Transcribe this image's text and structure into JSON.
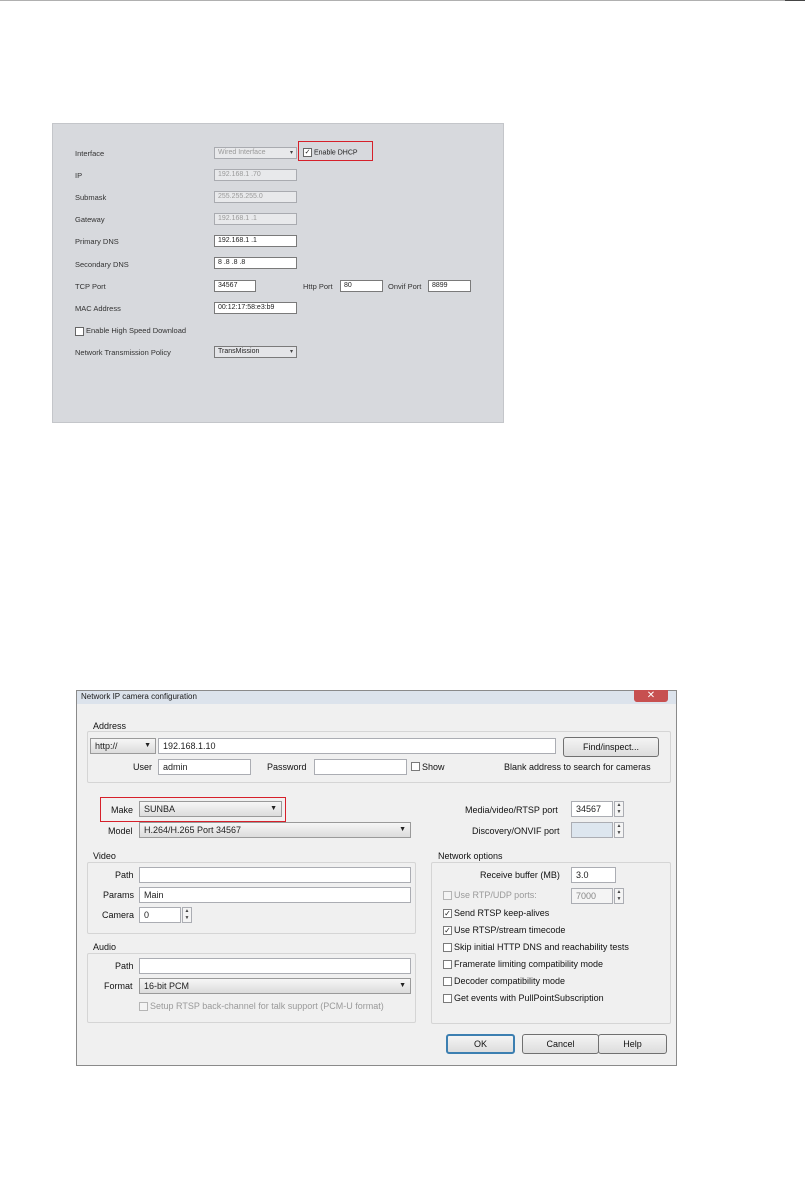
{
  "network_panel": {
    "interface": {
      "label": "Interface",
      "value": "Wired Interface"
    },
    "enable_dhcp": {
      "label": "Enable DHCP",
      "checked": true
    },
    "ip": {
      "label": "IP",
      "value": "192.168.1 .70"
    },
    "submask": {
      "label": "Submask",
      "value": "255.255.255.0"
    },
    "gateway": {
      "label": "Gateway",
      "value": "192.168.1 .1"
    },
    "primary_dns": {
      "label": "Primary DNS",
      "value": "192.168.1 .1"
    },
    "secondary_dns": {
      "label": "Secondary DNS",
      "value": "8 .8 .8 .8"
    },
    "tcp_port": {
      "label": "TCP Port",
      "value": "34567"
    },
    "http_port": {
      "label": "Http Port",
      "value": "80"
    },
    "onvif_port": {
      "label": "Onvif Port",
      "value": "8899"
    },
    "mac_address": {
      "label": "MAC Address",
      "value": "00:12:17:58:e3:b9"
    },
    "high_speed_download": {
      "label": "Enable High Speed Download",
      "checked": false
    },
    "transmission_policy": {
      "label": "Network Transmission Policy",
      "value": "TransMission"
    },
    "highlight_color": "#d6202a"
  },
  "dialog": {
    "title": "Network IP camera configuration",
    "close_symbol": "✕",
    "address": {
      "group_title": "Address",
      "protocol": "http://",
      "address_value": "192.168.1.10",
      "find_button": "Find/inspect...",
      "user_label": "User",
      "user_value": "admin",
      "password_label": "Password",
      "password_value": "",
      "show_label": "Show",
      "hint": "Blank address to search for cameras"
    },
    "make": {
      "label": "Make",
      "value": "SUNBA"
    },
    "model": {
      "label": "Model",
      "value": "H.264/H.265 Port 34567"
    },
    "media_port": {
      "label": "Media/video/RTSP port",
      "value": "34567"
    },
    "onvif_port": {
      "label": "Discovery/ONVIF port",
      "value": ""
    },
    "video": {
      "group_title": "Video",
      "path_label": "Path",
      "path_value": "",
      "params_label": "Params",
      "params_value": "Main",
      "camera_label": "Camera",
      "camera_value": "0"
    },
    "audio": {
      "group_title": "Audio",
      "path_label": "Path",
      "path_value": "",
      "format_label": "Format",
      "format_value": "16-bit PCM",
      "backchannel_label": "Setup RTSP back-channel for talk support (PCM-U format)"
    },
    "network_options": {
      "group_title": "Network options",
      "receive_buffer_label": "Receive buffer (MB)",
      "receive_buffer_value": "3.0",
      "rtp_udp_label": "Use RTP/UDP ports:",
      "rtp_udp_value": "7000",
      "options": [
        {
          "label": "Send RTSP keep-alives",
          "checked": true
        },
        {
          "label": "Use RTSP/stream timecode",
          "checked": true
        },
        {
          "label": "Skip initial HTTP DNS and reachability tests",
          "checked": false
        },
        {
          "label": "Framerate limiting compatibility mode",
          "checked": false
        },
        {
          "label": "Decoder compatibility mode",
          "checked": false
        },
        {
          "label": "Get events with PullPointSubscription",
          "checked": false
        }
      ]
    },
    "buttons": {
      "ok": "OK",
      "cancel": "Cancel",
      "help": "Help"
    },
    "accent_color": "#3c7fb1",
    "close_color": "#c75050"
  }
}
